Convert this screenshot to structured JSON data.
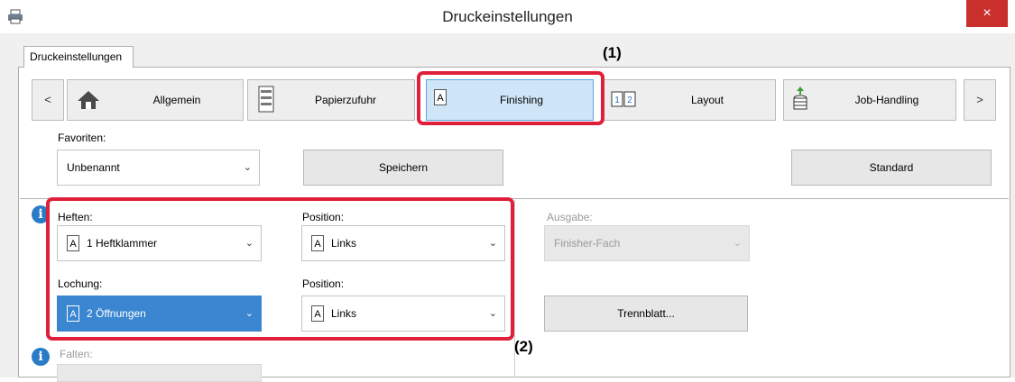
{
  "window": {
    "title": "Druckeinstellungen",
    "close_glyph": "×"
  },
  "tab": {
    "label": "Druckeinstellungen"
  },
  "nav": {
    "prev": "<",
    "next": ">",
    "buttons": [
      {
        "label": "Allgemein",
        "icon": "home-icon"
      },
      {
        "label": "Papierzufuhr",
        "icon": "paper-tray-icon"
      },
      {
        "label": "Finishing",
        "icon": "finishing-icon"
      },
      {
        "label": "Layout",
        "icon": "layout-icon"
      },
      {
        "label": "Job-Handling",
        "icon": "job-handling-icon"
      }
    ]
  },
  "favorites": {
    "label": "Favoriten:",
    "value": "Unbenannt",
    "save": "Speichern",
    "standard": "Standard"
  },
  "stapling": {
    "label": "Heften:",
    "value": "1 Heftklammer"
  },
  "staple_position": {
    "label": "Position:",
    "value": "Links"
  },
  "punch": {
    "label": "Lochung:",
    "value": "2 Öffnungen"
  },
  "punch_position": {
    "label": "Position:",
    "value": "Links"
  },
  "output": {
    "label": "Ausgabe:",
    "value": "Finisher-Fach"
  },
  "separator_page": {
    "label": "Trennblatt..."
  },
  "fold": {
    "label": "Falten:"
  },
  "callouts": {
    "one": "(1)",
    "two": "(2)"
  },
  "colors": {
    "highlight": "#e0203a",
    "selected": "#3a86d0",
    "info": "#2a7bc6"
  }
}
